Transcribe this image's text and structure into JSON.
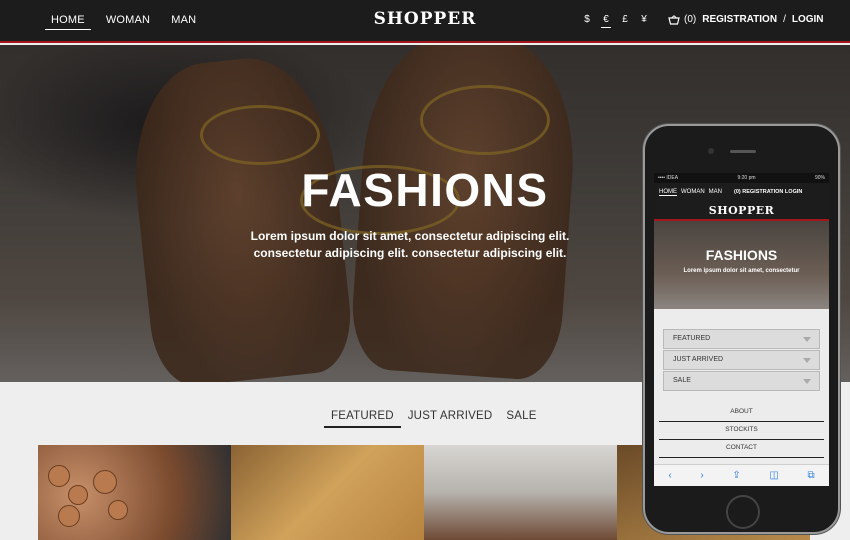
{
  "header": {
    "nav": [
      "HOME",
      "WOMAN",
      "MAN"
    ],
    "logo": "SHOPPER",
    "currencies": [
      "$",
      "€",
      "£",
      "¥"
    ],
    "cart_count": "(0)",
    "registration": "REGISTRATION",
    "separator": "/",
    "login": "LOGIN"
  },
  "hero": {
    "title": "FASHIONS",
    "subtitle": "Lorem ipsum dolor sit amet, consectetur adipiscing elit. consectetur adipiscing elit. consectetur adipiscing elit."
  },
  "tabs": [
    "FEATURED",
    "JUST ARRIVED",
    "SALE"
  ],
  "mobile": {
    "status_left": "•••• IDEA",
    "status_time": "9:20 pm",
    "status_right": "90%",
    "nav": [
      "HOME",
      "WOMAN",
      "MAN"
    ],
    "account": "(0) REGISTRATION  LOGIN",
    "logo": "SHOPPER",
    "hero_title": "FASHIONS",
    "hero_sub": "Lorem ipsum dolor sit amet, consectetur",
    "accordion": [
      "FEATURED",
      "JUST ARRIVED",
      "SALE"
    ],
    "links": [
      "ABOUT",
      "STOCKITS",
      "CONTACT"
    ],
    "toolbar": [
      "‹",
      "›",
      "⇪",
      "◫",
      "⧉"
    ]
  },
  "colors": {
    "accent": "#a3161c",
    "header_bg": "#1c1c1c",
    "page_bg": "#eeeeee"
  }
}
